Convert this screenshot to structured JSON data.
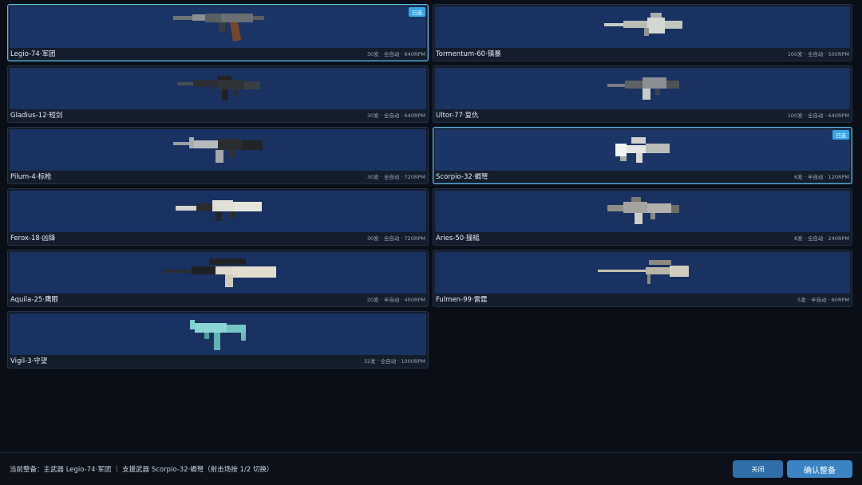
{
  "weapons": [
    {
      "name": "Legio-74·军团",
      "stats": "30发 · 全自动 · 640RPM",
      "badge": "已选",
      "selected": true,
      "icon": "assault-rifle-icon"
    },
    {
      "name": "Tormentum-60·镇暴",
      "stats": "100发 · 全自动 · 500RPM",
      "badge": "",
      "selected": false,
      "icon": "machine-gun-icon"
    },
    {
      "name": "Gladius-12·短剑",
      "stats": "30发 · 全自动 · 640RPM",
      "badge": "",
      "selected": false,
      "icon": "carbine-icon"
    },
    {
      "name": "Ultor-77·复仇",
      "stats": "100发 · 全自动 · 640RPM",
      "badge": "",
      "selected": false,
      "icon": "lmg-icon"
    },
    {
      "name": "Pilum-4·标枪",
      "stats": "30发 · 全自动 · 720RPM",
      "badge": "",
      "selected": false,
      "icon": "m4-rifle-icon"
    },
    {
      "name": "Scorpio-32·蝎弩",
      "stats": "6发 · 半自动 · 120RPM",
      "badge": "已选",
      "selected": true,
      "icon": "grenade-launcher-icon"
    },
    {
      "name": "Ferox-18·凶锋",
      "stats": "30发 · 全自动 · 720RPM",
      "badge": "",
      "selected": false,
      "icon": "suppressed-rifle-icon"
    },
    {
      "name": "Aries-50·撞槌",
      "stats": "8发 · 全自动 · 240RPM",
      "badge": "",
      "selected": false,
      "icon": "shotgun-icon"
    },
    {
      "name": "Aquila-25·鹰眼",
      "stats": "20发 · 半自动 · 400RPM",
      "badge": "",
      "selected": false,
      "icon": "dmr-icon"
    },
    {
      "name": "Fulmen-99·雷霆",
      "stats": "5发 · 半自动 · 60RPM",
      "badge": "",
      "selected": false,
      "icon": "sniper-rifle-icon"
    },
    {
      "name": "Vigil-3·守望",
      "stats": "32发 · 全自动 · 1000RPM",
      "badge": "",
      "selected": false,
      "icon": "smg-icon"
    }
  ],
  "footer": {
    "summary": "当前整备：主武器 Legio-74·军团 ｜ 支援武器 Scorpio-32·蝎弩（射击场按 1/2 切换）",
    "close_label": "关闭",
    "confirm_label": "确认整备"
  },
  "colors": {
    "accent": "#39a6e6",
    "preview_bg": "#1a3262",
    "card_bg": "#141d2b",
    "page_bg": "#0a0f17"
  }
}
